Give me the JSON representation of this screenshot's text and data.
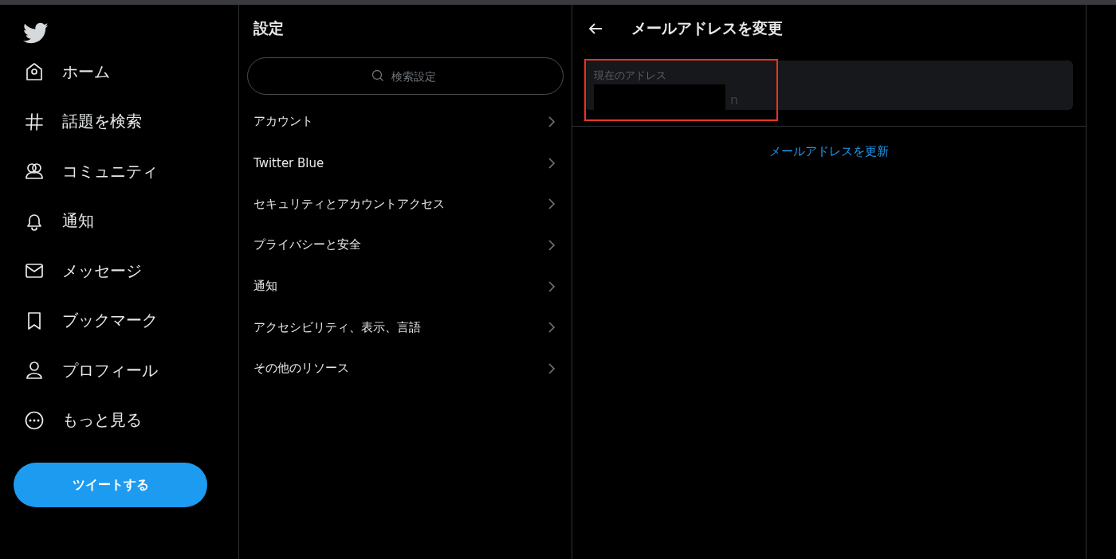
{
  "nav": {
    "items": [
      {
        "label": "ホーム",
        "kind": "home"
      },
      {
        "label": "話題を検索",
        "kind": "hash"
      },
      {
        "label": "コミュニティ",
        "kind": "people"
      },
      {
        "label": "通知",
        "kind": "bell"
      },
      {
        "label": "メッセージ",
        "kind": "mail"
      },
      {
        "label": "ブックマーク",
        "kind": "bookmark"
      },
      {
        "label": "プロフィール",
        "kind": "person"
      },
      {
        "label": "もっと見る",
        "kind": "more"
      }
    ],
    "tweet_button": "ツイートする"
  },
  "settings": {
    "title": "設定",
    "search": {
      "placeholder": "検索設定"
    },
    "items": [
      "アカウント",
      "Twitter Blue",
      "セキュリティとアカウントアクセス",
      "プライバシーと安全",
      "通知",
      "アクセシビリティ、表示、言語",
      "その他のリソース"
    ]
  },
  "detail": {
    "title": "メールアドレスを変更",
    "field": {
      "label": "現在のアドレス",
      "value_visible": "n",
      "redacted": true,
      "highlighted": true
    },
    "link": "メールアドレスを更新"
  }
}
